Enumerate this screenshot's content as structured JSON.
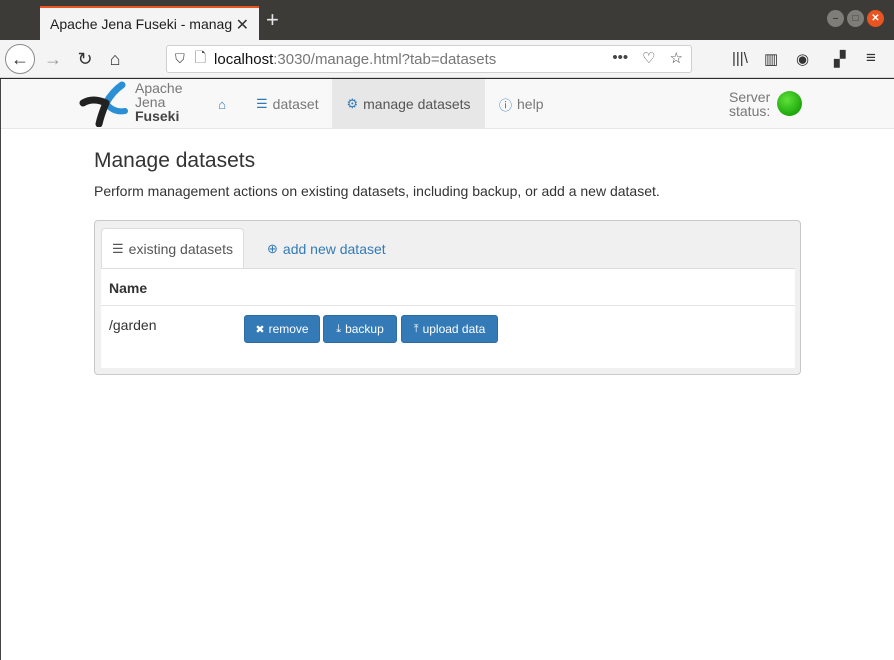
{
  "browser": {
    "tab_title": "Apache Jena Fuseki - manag",
    "url_host": "localhost",
    "url_rest": ":3030/manage.html?tab=datasets",
    "more_label": "•••"
  },
  "app": {
    "brand": [
      "Apache",
      "Jena",
      "Fuseki"
    ],
    "nav": {
      "dataset": "dataset",
      "manage": "manage datasets",
      "help": "help"
    },
    "server_status_line1": "Server",
    "server_status_line2": "status:",
    "server_status_color": "#2fbf18"
  },
  "main": {
    "title": "Manage datasets",
    "lead": "Perform management actions on existing datasets, including backup, or add a new dataset.",
    "tabs": {
      "existing": "existing datasets",
      "add": "add new dataset"
    },
    "table": {
      "header_name": "Name",
      "rows": [
        {
          "name": "/garden",
          "actions": [
            "remove",
            "backup",
            "upload data"
          ]
        }
      ]
    }
  },
  "colors": {
    "accent": "#337ab7",
    "tab_accent": "#e95420"
  }
}
